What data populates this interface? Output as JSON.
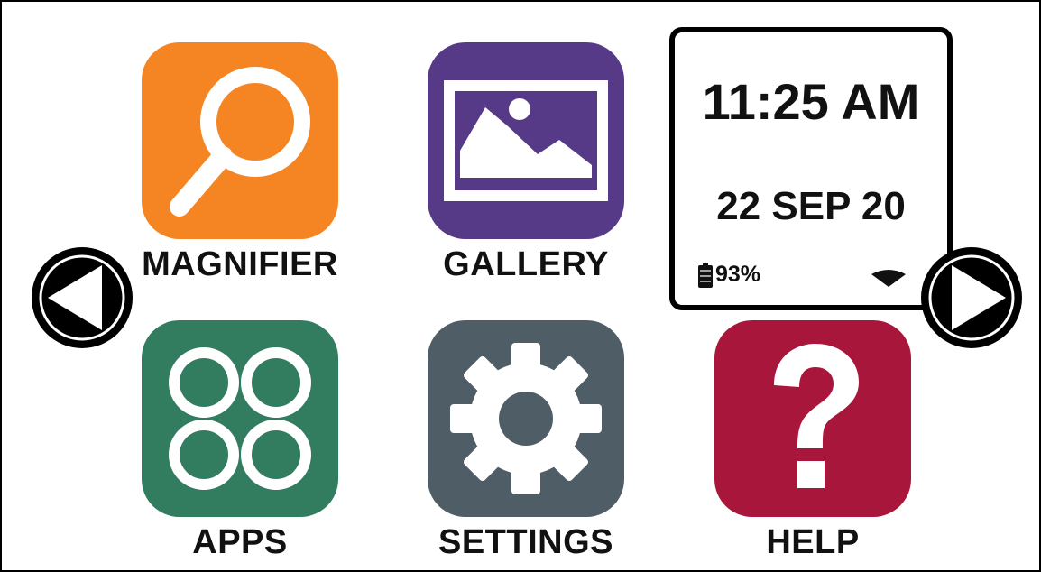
{
  "tiles": [
    {
      "label": "MAGNIFIER",
      "color": "#F58422",
      "icon": "magnifier-icon"
    },
    {
      "label": "GALLERY",
      "color": "#573A87",
      "icon": "gallery-icon"
    },
    {
      "label": "APPS",
      "color": "#327D5F",
      "icon": "apps-icon"
    },
    {
      "label": "SETTINGS",
      "color": "#4F5D66",
      "icon": "gear-icon"
    },
    {
      "label": "HELP",
      "color": "#A8163C",
      "icon": "question-mark-icon"
    }
  ],
  "status": {
    "time": "11:25 AM",
    "date": "22 SEP 20",
    "battery_text": "93%",
    "battery_percent": 93,
    "wifi_icon": "wifi-icon"
  },
  "nav": {
    "prev_icon": "arrow-left-icon",
    "next_icon": "arrow-right-icon"
  }
}
